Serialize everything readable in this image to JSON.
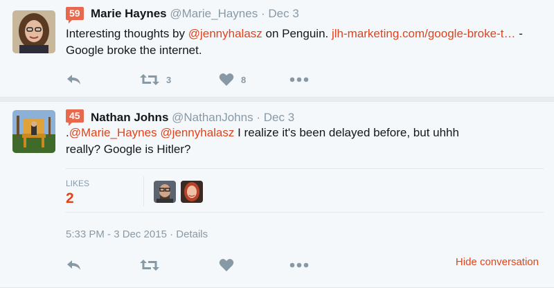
{
  "tweets": [
    {
      "score": "59",
      "name": "Marie Haynes",
      "handle": "@Marie_Haynes",
      "date": "Dec 3",
      "text_parts": [
        {
          "text": "Interesting thoughts by ",
          "link": false
        },
        {
          "text": "@jennyhalasz",
          "link": true
        },
        {
          "text": " on Penguin. ",
          "link": false
        },
        {
          "text": "jlh-marketing.com/google-broke-t…",
          "link": true
        },
        {
          "text": " - Google broke the internet.",
          "link": false
        }
      ],
      "retweet_count": "3",
      "like_count": "8"
    },
    {
      "score": "45",
      "name": "Nathan Johns",
      "handle": "@NathanJohns",
      "date": "Dec 3",
      "likes_label": "LIKES",
      "likes_count": "2",
      "timestamp": "5:33 PM - 3 Dec 2015",
      "details": "Details",
      "hide_conversation": "Hide conversation"
    }
  ],
  "tweet2_text": {
    "p1": ".",
    "m1": "@Marie_Haynes",
    "sp": " ",
    "m2": "@jennyhalasz",
    "rest1": " I realize it's been delayed before, but uhhh",
    "rest2": "really? Google is Hitler?"
  },
  "icons": [
    "reply-icon",
    "retweet-icon",
    "heart-icon",
    "more-icon"
  ],
  "colors": {
    "accent": "#e0431b",
    "score_badge": "#e8684d",
    "muted": "#8899a6"
  }
}
